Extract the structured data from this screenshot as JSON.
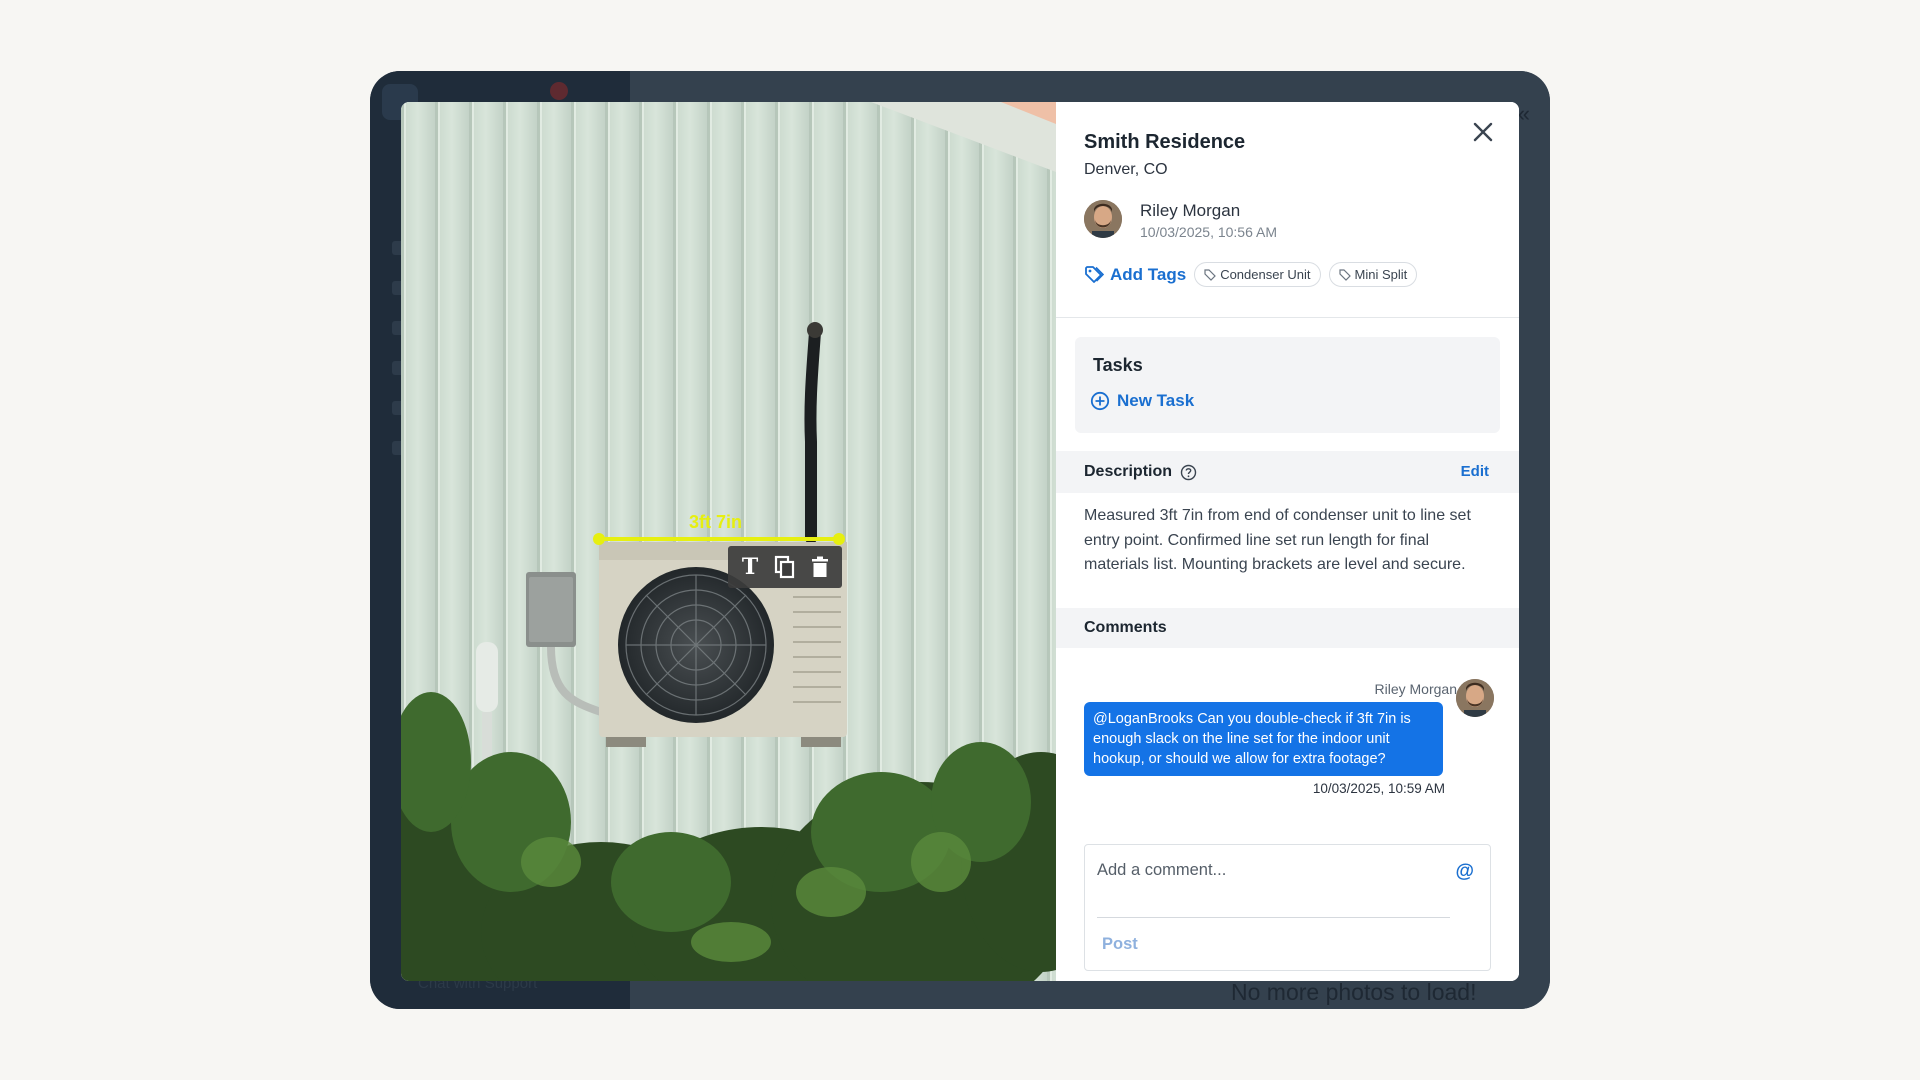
{
  "background": {
    "empty_text": "No more photos to load!",
    "support_text": "Chat with Support",
    "collapse_glyph": "«"
  },
  "photo": {
    "measurement_label": "3ft 7in",
    "toolbar": {
      "text_tool": "T",
      "text_tool_icon": "text-tool-icon",
      "duplicate_icon": "copy-icon",
      "delete_icon": "trash-icon"
    }
  },
  "panel": {
    "title": "Smith Residence",
    "location": "Denver, CO",
    "author": {
      "name": "Riley Morgan",
      "timestamp": "10/03/2025, 10:56 AM"
    },
    "tags": {
      "add_label": "Add Tags",
      "items": [
        "Condenser Unit",
        "Mini Split"
      ]
    },
    "tasks": {
      "title": "Tasks",
      "new_task_label": "New Task"
    },
    "description": {
      "title": "Description",
      "edit_label": "Edit",
      "text": "Measured 3ft 7in from end of condenser unit to line set entry point. Confirmed line set run length for final materials list. Mounting brackets are level and secure."
    },
    "comments": {
      "title": "Comments",
      "items": [
        {
          "author": "Riley Morgan",
          "text": "@LoganBrooks Can you double-check if 3ft 7in is enough slack on the line set for the indoor unit hookup, or should we allow for extra footage?",
          "timestamp": "10/03/2025, 10:59 AM"
        }
      ],
      "input_placeholder": "Add a comment...",
      "mention_glyph": "@",
      "post_label": "Post"
    }
  },
  "colors": {
    "accent": "#1a6fd0",
    "bubble": "#1473e6",
    "measure": "#e6ef10"
  }
}
